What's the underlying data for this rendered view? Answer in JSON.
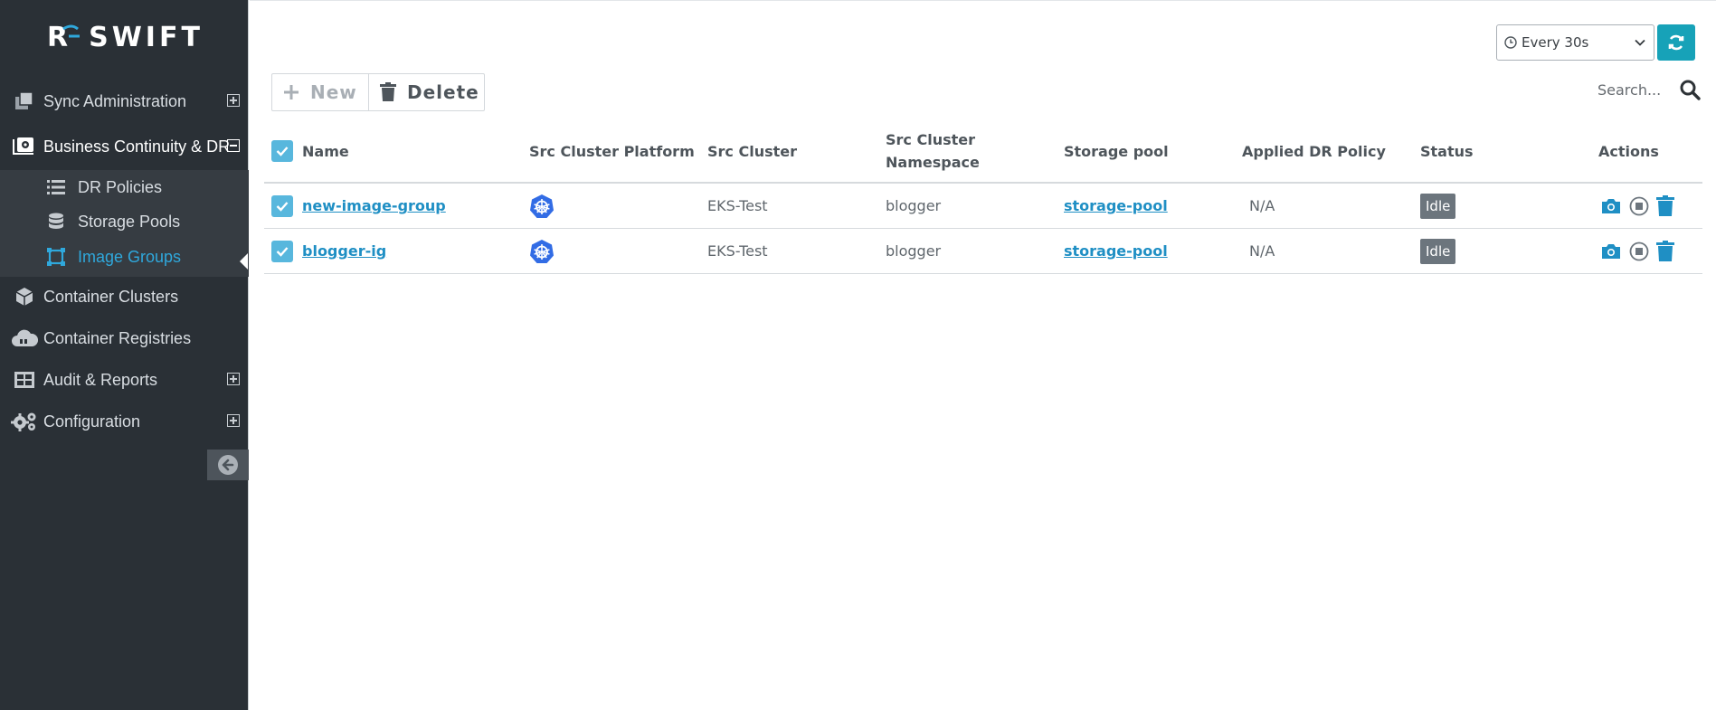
{
  "brand": {
    "initial": "R",
    "name": "SWIFT"
  },
  "sidebar": {
    "items": [
      {
        "label": "Sync Administration",
        "icon": "copy-icon",
        "expandable": true
      },
      {
        "label": "Business Continuity & DR",
        "icon": "continuity-gear-icon",
        "expandable": true,
        "expanded": true
      },
      {
        "label": "Container Clusters",
        "icon": "cube-icon",
        "expandable": false
      },
      {
        "label": "Container Registries",
        "icon": "cloud-icon",
        "expandable": false
      },
      {
        "label": "Audit & Reports",
        "icon": "table-icon",
        "expandable": true
      },
      {
        "label": "Configuration",
        "icon": "gears-icon",
        "expandable": true
      }
    ],
    "subitems": [
      {
        "label": "DR Policies",
        "icon": "list-icon"
      },
      {
        "label": "Storage Pools",
        "icon": "database-icon"
      },
      {
        "label": "Image Groups",
        "icon": "image-group-icon",
        "current": true
      }
    ]
  },
  "refresh": {
    "interval_label": "Every 30s"
  },
  "toolbar": {
    "new_label": "New",
    "delete_label": "Delete"
  },
  "search": {
    "placeholder": "Search..."
  },
  "table": {
    "headers": {
      "name": "Name",
      "platform": "Src Cluster Platform",
      "cluster": "Src Cluster",
      "namespace_line1": "Src Cluster",
      "namespace_line2": "Namespace",
      "storage": "Storage pool",
      "policy": "Applied DR Policy",
      "status": "Status",
      "actions": "Actions"
    },
    "rows": [
      {
        "name": "new-image-group",
        "platform_icon": "kubernetes-icon",
        "cluster": "EKS-Test",
        "namespace": "blogger",
        "storage": "storage-pool",
        "policy": "N/A",
        "status": "Idle"
      },
      {
        "name": "blogger-ig",
        "platform_icon": "kubernetes-icon",
        "cluster": "EKS-Test",
        "namespace": "blogger",
        "storage": "storage-pool",
        "policy": "N/A",
        "status": "Idle"
      }
    ]
  },
  "colors": {
    "sidebar_bg": "#2a3036",
    "accent": "#17a2b8",
    "link": "#1f8fc4",
    "checkbox": "#58b7dd",
    "status_badge": "#6c757d",
    "kubernetes": "#326ce5"
  }
}
